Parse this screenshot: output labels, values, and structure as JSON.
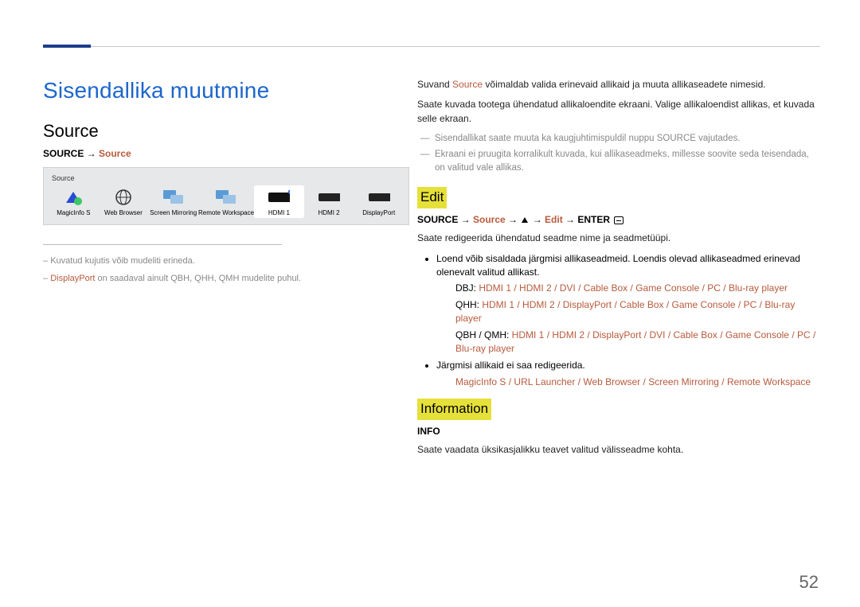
{
  "page_number": "52",
  "title": "Sisendallika muutmine",
  "left": {
    "heading": "Source",
    "path_prefix": "SOURCE → ",
    "path_source": "Source",
    "panel_label": "Source",
    "items": [
      {
        "label": "MagicInfo S"
      },
      {
        "label": "Web Browser"
      },
      {
        "label": "Screen Mirroring"
      },
      {
        "label": "Remote Workspace"
      },
      {
        "label": "HDMI 1",
        "active": true
      },
      {
        "label": "HDMI 2"
      },
      {
        "label": "DisplayPort"
      }
    ],
    "note1_dash": "– ",
    "note1": "Kuvatud kujutis võib mudeliti erineda.",
    "note2_dash": "– ",
    "note2_brand": "DisplayPort",
    "note2_tail": " on saadaval ainult QBH, QHH, QMH mudelite puhul."
  },
  "right": {
    "p1a": "Suvand ",
    "p1b": "Source",
    "p1c": " võimaldab valida erinevaid allikaid ja muuta allikaseadete nimesid.",
    "p2": "Saate kuvada tootega ühendatud allikaloendite ekraani. Valige allikaloendist allikas, et kuvada selle ekraan.",
    "d1": "Sisendallikat saate muuta ka kaugjuhtimispuldil nuppu SOURCE vajutades.",
    "d2": "Ekraani ei pruugita korralikult kuvada, kui allikaseadmeks, millesse soovite seda teisendada, on valitud vale allikas.",
    "edit": {
      "heading": "Edit",
      "path_a": "SOURCE → ",
      "path_src": "Source",
      "path_b": " → ",
      "path_c": " → ",
      "path_edit": "Edit",
      "path_d": " → ENTER ",
      "p": "Saate redigeerida ühendatud seadme nime ja seadmetüüpi.",
      "li1": "Loend võib sisaldada järgmisi allikaseadmeid. Loendis olevad allikaseadmed erinevad olenevalt valitud allikast.",
      "dbj_label": "DBJ: ",
      "dbj_items": [
        "HDMI 1",
        "HDMI 2",
        "DVI",
        "Cable Box",
        "Game Console",
        "PC",
        "Blu-ray player"
      ],
      "qhh_label": "QHH: ",
      "qhh_items": [
        "HDMI 1",
        "HDMI 2",
        "DisplayPort",
        "Cable Box",
        "Game Console",
        "PC",
        "Blu-ray player"
      ],
      "qbh_label": "QBH / QMH: ",
      "qbh_items": [
        "HDMI 1",
        "HDMI 2",
        "DisplayPort",
        "DVI",
        "Cable Box",
        "Game Console",
        "PC",
        "Blu-ray player"
      ],
      "li2": "Järgmisi allikaid ei saa redigeerida.",
      "li2_items": [
        "MagicInfo S",
        "URL Launcher",
        "Web Browser",
        "Screen Mirroring",
        "Remote Workspace"
      ]
    },
    "info": {
      "heading": "Information",
      "path": "INFO",
      "p": "Saate vaadata üksikasjalikku teavet valitud välisseadme kohta."
    }
  }
}
